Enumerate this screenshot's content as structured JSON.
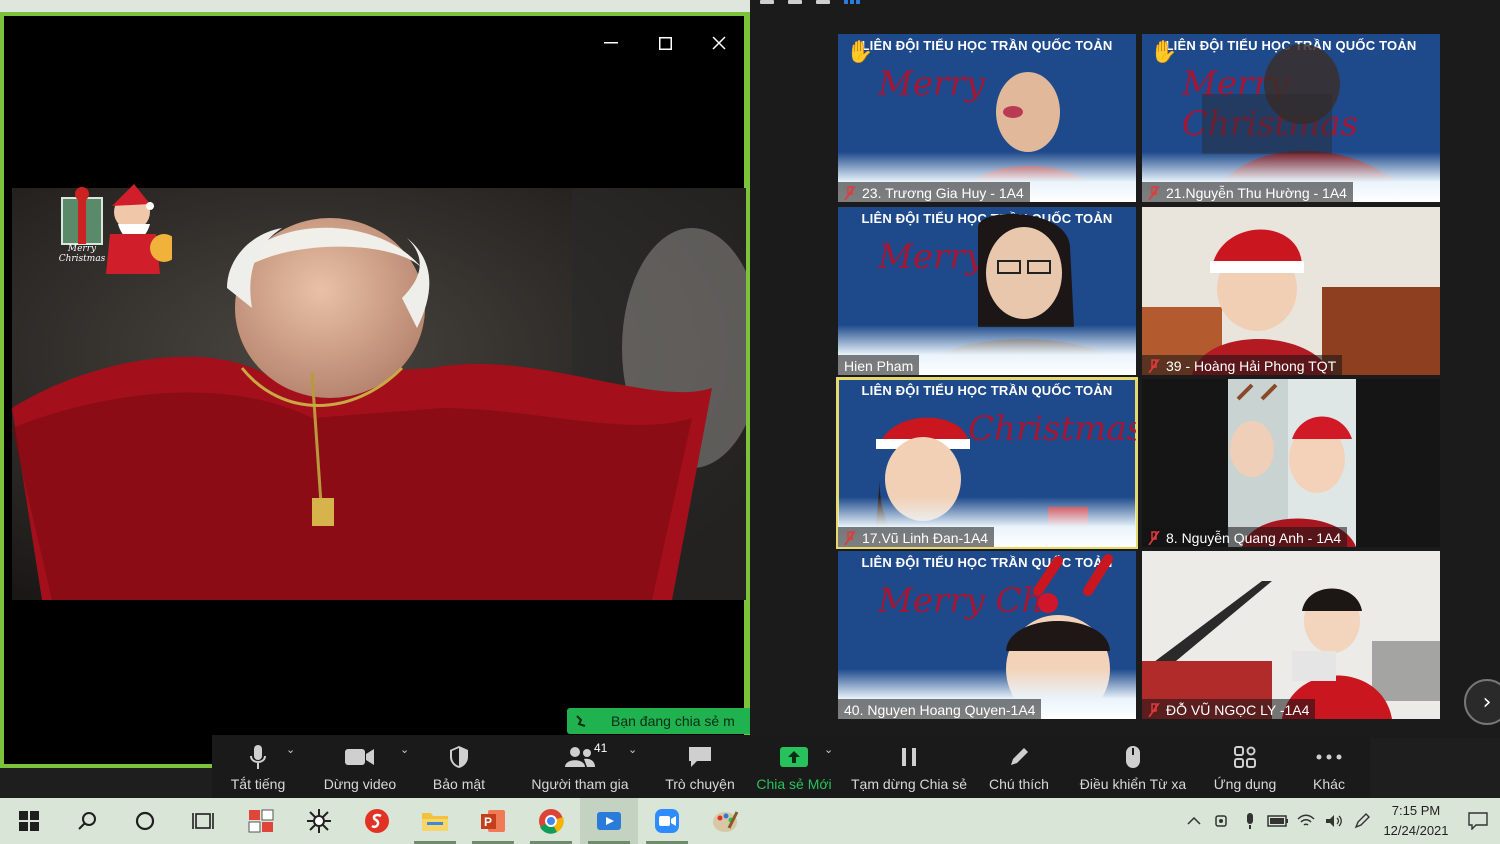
{
  "shared_window": {
    "controls": {
      "minimize": "—",
      "maximize": "☐",
      "close": "✕"
    },
    "sticker_text": "Merry Christmas"
  },
  "share_banner": {
    "text": "Bạn đang chia sẻ m"
  },
  "gallery": {
    "tiles": [
      {
        "name": "23. Trương Gia Huy - 1A4",
        "banner": "LIÊN ĐỘI TIỂU HỌC TRẦN QUỐC TOẢN",
        "muted": true,
        "hand_raised": true,
        "background": "christmas"
      },
      {
        "name": "21.Nguyễn Thu Hường - 1A4",
        "banner": "LIÊN ĐỘI TIỂU HỌC TRẦN QUỐC TOẢN",
        "muted": true,
        "hand_raised": true,
        "background": "christmas"
      },
      {
        "name": "Hien Pham",
        "banner": "LIÊN ĐỘI TIỂU HỌC TRẦN QUỐC TOẢN",
        "muted": false,
        "hand_raised": false,
        "background": "christmas"
      },
      {
        "name": "39 - Hoàng Hải Phong TQT",
        "banner": "",
        "muted": true,
        "hand_raised": false,
        "background": "room"
      },
      {
        "name": "17.Vũ Linh Đan-1A4",
        "banner": "LIÊN ĐỘI TIỂU HỌC TRẦN QUỐC TOẢN",
        "muted": true,
        "hand_raised": false,
        "background": "christmas",
        "active_speaker": true
      },
      {
        "name": "8. Nguyễn Quang Anh - 1A4",
        "banner": "",
        "muted": true,
        "hand_raised": false,
        "background": "portrait"
      },
      {
        "name": "40. Nguyen Hoang Quyen-1A4",
        "banner": "LIÊN ĐỘI TIỂU HỌC TRẦN QUỐC TOẢN",
        "muted": false,
        "hand_raised": false,
        "background": "christmas"
      },
      {
        "name": "ĐỖ VŨ NGỌC LY -1A4",
        "banner": "",
        "muted": true,
        "hand_raised": false,
        "background": "stairs"
      }
    ],
    "next_page": "›"
  },
  "toolbar": {
    "mute": "Tắt tiếng",
    "stop_video": "Dừng video",
    "security": "Bảo mật",
    "participants": "Người tham gia",
    "participants_count": "41",
    "chat": "Trò chuyện",
    "new_share": "Chia sẻ Mới",
    "pause_share": "Tạm dừng Chia sẻ",
    "annotate": "Chú thích",
    "remote_control": "Điều khiển Từ xa",
    "apps": "Ứng dụng",
    "more": "Khác"
  },
  "taskbar": {
    "time": "7:15 PM",
    "date": "12/24/2021"
  },
  "colors": {
    "share_border": "#7cc23a",
    "share_green": "#20b24f",
    "active_outline": "#e7d96b",
    "tile_blue": "#1e4a8c",
    "merry_red": "#b3122b"
  }
}
